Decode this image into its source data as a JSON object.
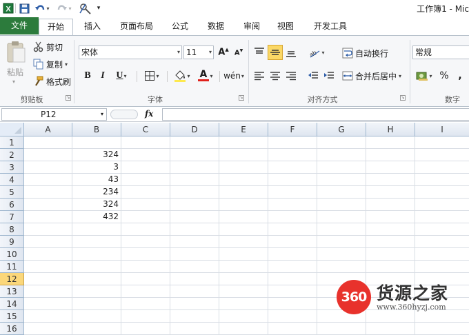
{
  "window": {
    "title": "工作簿1 - Mic"
  },
  "tabs": [
    "文件",
    "开始",
    "插入",
    "页面布局",
    "公式",
    "数据",
    "审阅",
    "视图",
    "开发工具"
  ],
  "clipboard": {
    "paste": "粘贴",
    "cut": "剪切",
    "copy": "复制",
    "format_painter": "格式刷",
    "group": "剪贴板"
  },
  "font": {
    "name": "宋体",
    "size": "11",
    "bold": "B",
    "italic": "I",
    "underline": "U",
    "fill_letter": "A",
    "group": "字体"
  },
  "alignment": {
    "wrap": "自动换行",
    "merge": "合并后居中",
    "group": "对齐方式"
  },
  "number": {
    "format": "常规",
    "percent": "%",
    "comma": ",",
    "group": "数字"
  },
  "formula_bar": {
    "name_box": "P12",
    "fx": "fx",
    "value": ""
  },
  "columns": [
    "A",
    "B",
    "C",
    "D",
    "E",
    "F",
    "G",
    "H",
    "I"
  ],
  "rows": [
    "1",
    "2",
    "3",
    "4",
    "5",
    "6",
    "7",
    "8",
    "9",
    "10",
    "11",
    "12",
    "13",
    "14",
    "15",
    "16"
  ],
  "selected_row": "12",
  "cells_B": [
    "324",
    "3",
    "43",
    "234",
    "324",
    "432"
  ],
  "watermark": {
    "logo": "360",
    "name": "货源之家",
    "url": "www.360hyzj.com"
  },
  "colors": {
    "file_tab": "#2c7b3c",
    "active": "#fbd866",
    "font_color": "#e0201b"
  }
}
